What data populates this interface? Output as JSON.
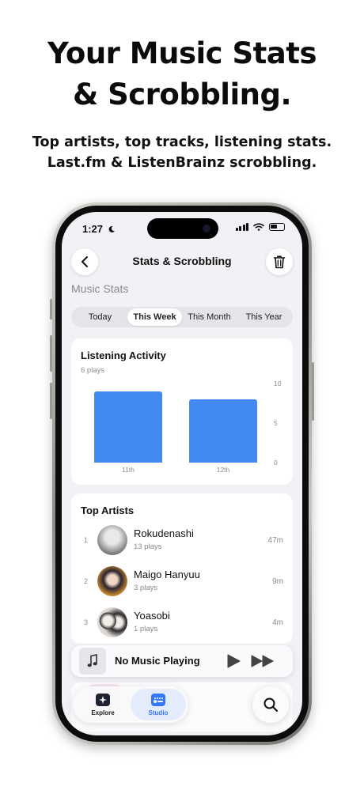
{
  "promo": {
    "headline_line1": "Your Music Stats",
    "headline_line2": "& Scrobbling.",
    "subline_line1": "Top artists, top tracks, listening stats.",
    "subline_line2": "Last.fm & ListenBrainz scrobbling."
  },
  "status_bar": {
    "time": "1:27"
  },
  "nav": {
    "title": "Stats & Scrobbling",
    "back_icon": "chevron-left-icon",
    "trash_icon": "trash-icon"
  },
  "section_label": "Music Stats",
  "segments": [
    {
      "label": "Today",
      "selected": false
    },
    {
      "label": "This Week",
      "selected": true
    },
    {
      "label": "This Month",
      "selected": false
    },
    {
      "label": "This Year",
      "selected": false
    }
  ],
  "listening_activity": {
    "title": "Listening Activity",
    "subtitle": "6 plays"
  },
  "chart_data": {
    "type": "bar",
    "title": "Listening Activity",
    "categories": [
      "11th",
      "12th"
    ],
    "values": [
      9,
      8
    ],
    "ylim": [
      0,
      10
    ],
    "yticks": [
      "10",
      "5",
      "0"
    ],
    "xlabel": "",
    "ylabel": "",
    "bar_color": "#4289f2",
    "grid": false
  },
  "top_artists": {
    "title": "Top Artists",
    "items": [
      {
        "rank": "1",
        "name": "Rokudenashi",
        "plays": "13 plays",
        "time": "47m"
      },
      {
        "rank": "2",
        "name": "Maigo Hanyuu",
        "plays": "3 plays",
        "time": "9m"
      },
      {
        "rank": "3",
        "name": "Yoasobi",
        "plays": "1 plays",
        "time": "4m"
      }
    ]
  },
  "mini_player": {
    "title": "No Music Playing",
    "art_icon": "music-note-icon",
    "play_icon": "play-icon",
    "next_icon": "fast-forward-icon"
  },
  "tabbar": {
    "tabs": [
      {
        "label": "Explore",
        "icon": "explore-icon",
        "selected": false
      },
      {
        "label": "Studio",
        "icon": "studio-icon",
        "selected": true
      }
    ],
    "search_icon": "search-icon"
  },
  "colors": {
    "accent": "#3478f6",
    "bar": "#4289f2",
    "secondary_text": "#8a8a8e",
    "background": "#f2f2f6"
  }
}
